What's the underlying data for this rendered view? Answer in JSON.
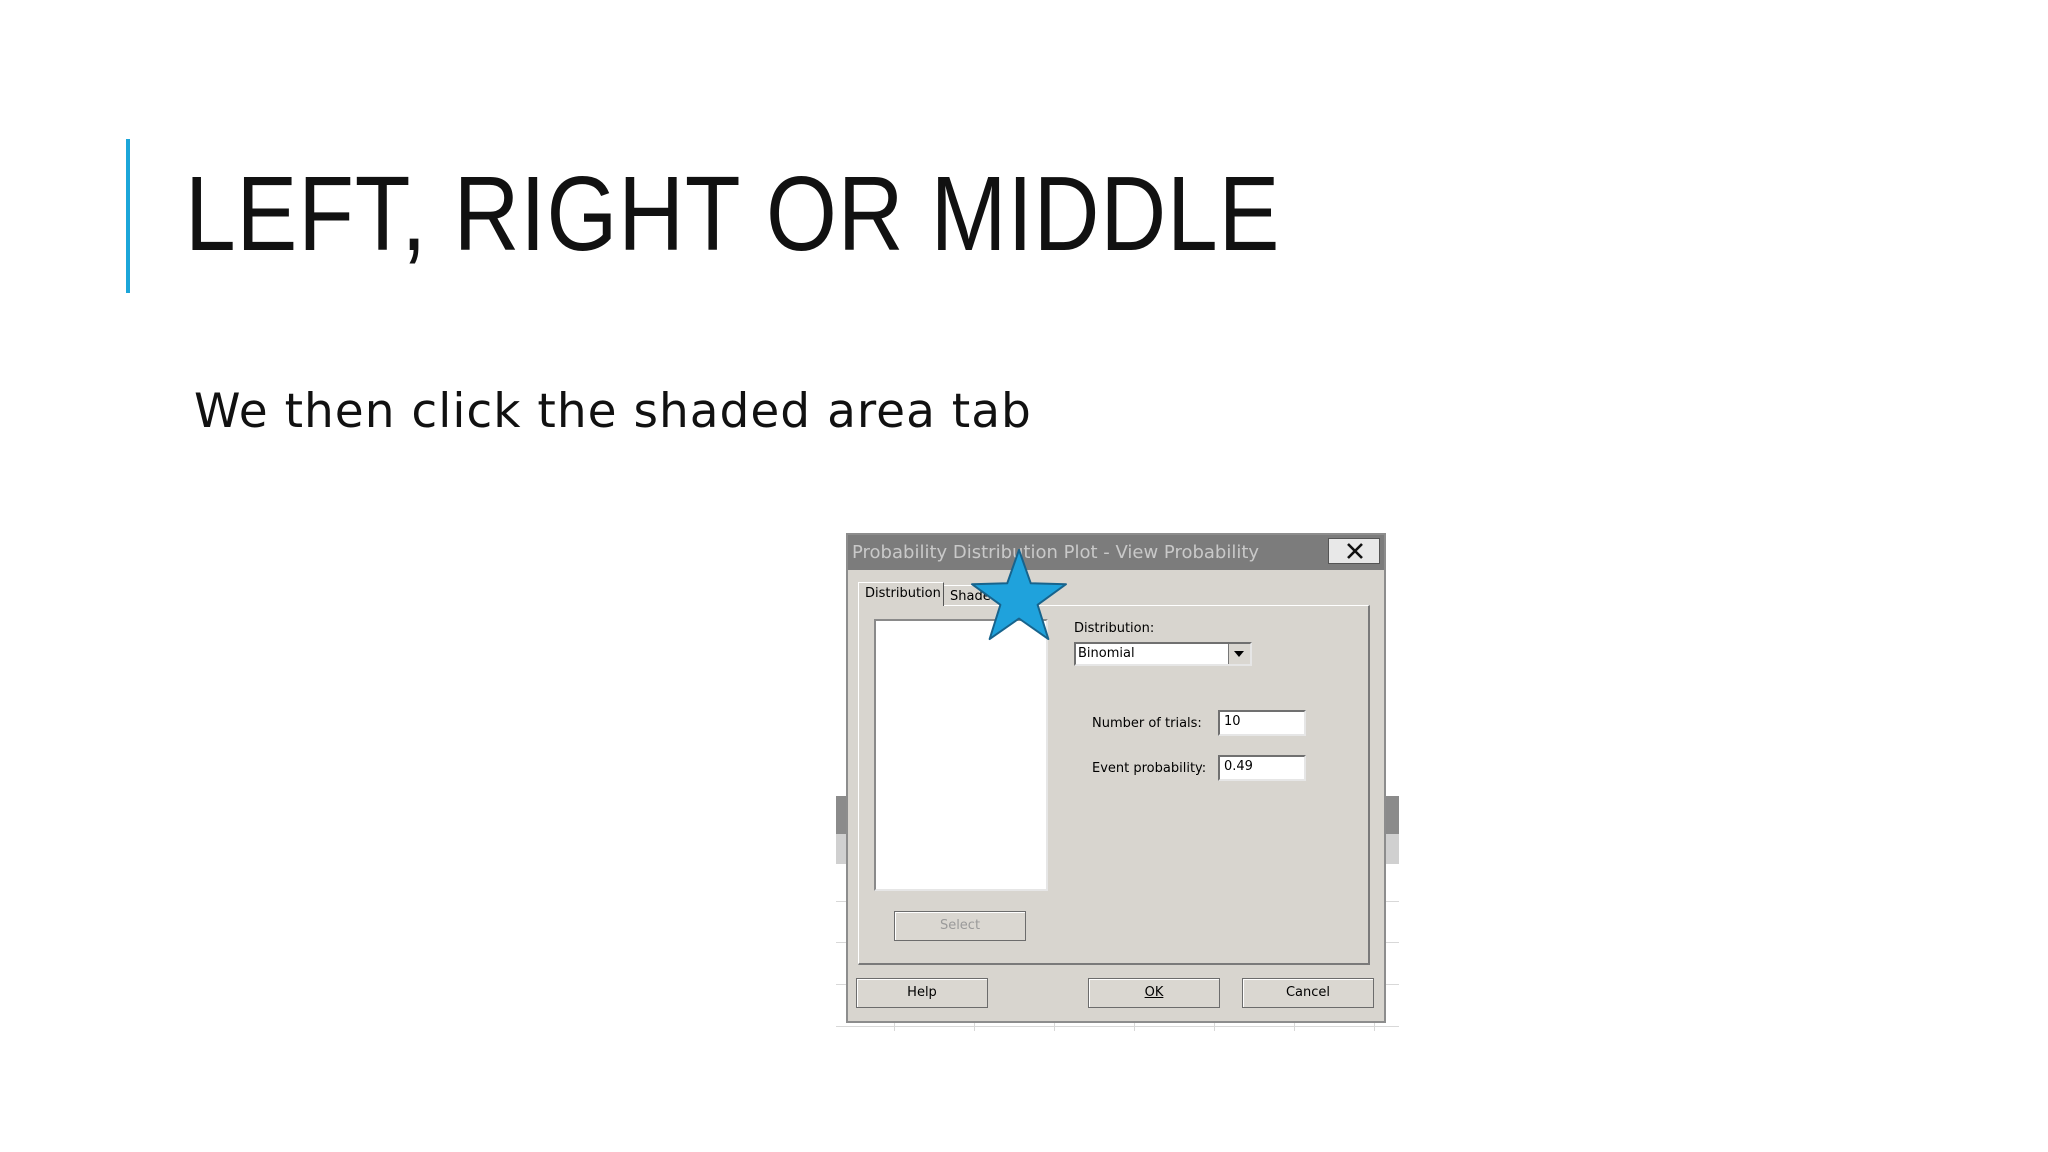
{
  "slide": {
    "title": "LEFT, RIGHT OR MIDDLE",
    "body": "We then click the shaded area tab",
    "accent_color": "#1ca6d9"
  },
  "dialog": {
    "title": "Probability Distribution Plot - View Probability",
    "close_icon": "close-x-icon",
    "tabs": [
      {
        "label": "Distribution",
        "active": true
      },
      {
        "label": "Shaded",
        "active": false
      }
    ],
    "select_label": "Select",
    "distribution_label": "Distribution:",
    "distribution_value": "Binomial",
    "trials_label": "Number of trials:",
    "trials_value": "10",
    "probability_label": "Event probability:",
    "probability_value": "0.49",
    "help_label": "Help",
    "ok_label": "OK",
    "cancel_label": "Cancel"
  },
  "annotation": {
    "shape": "star-icon",
    "color": "#1fa2dc"
  }
}
